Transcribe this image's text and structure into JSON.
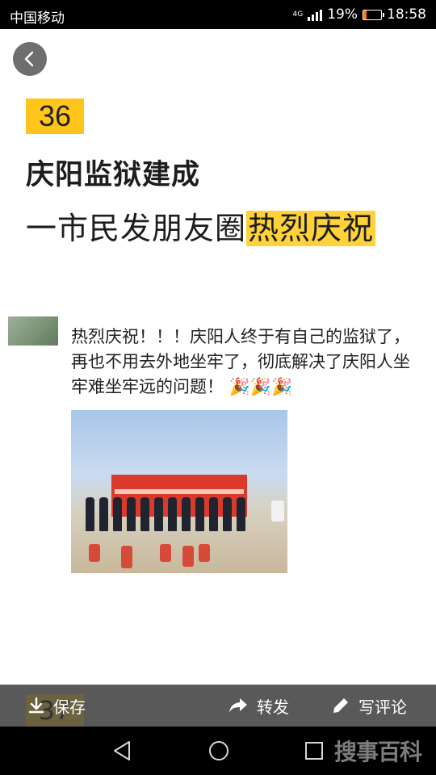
{
  "status": {
    "carrier": "中国移动",
    "network": "4G",
    "battery": "19%",
    "battery_level": 0.19,
    "time": "18:58"
  },
  "article": {
    "issue_number": "36",
    "headline": "庆阳监狱建成",
    "subline_plain": "一市民发朋友圈",
    "subline_highlight": "热烈庆祝",
    "highlight_color": "#ffd23a",
    "post": {
      "text": "热烈庆祝！！！庆阳人终于有自己的监狱了，再也不用去外地坐牢了，彻底解决了庆阳人坐牢难坐牢远的问题！",
      "emoji": "🎉🎉🎉"
    },
    "next_issue_number": "37"
  },
  "actions": {
    "save_label": "保存",
    "share_label": "转发",
    "comment_label": "写评论"
  },
  "icons": [
    "back-arrow-icon",
    "download-icon",
    "share-arrow-icon",
    "pencil-icon",
    "nav-back-icon",
    "nav-home-icon",
    "nav-recents-icon"
  ],
  "watermark": "搜事百科"
}
